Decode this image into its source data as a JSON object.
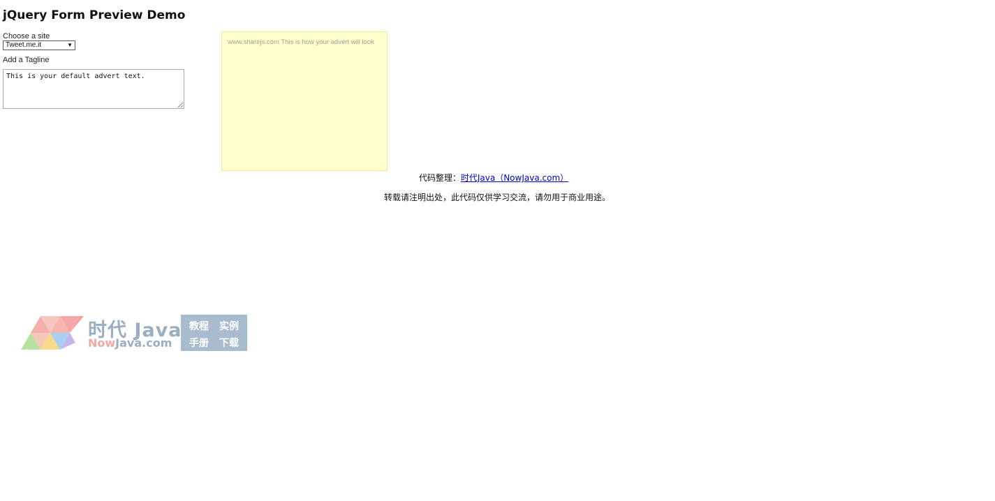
{
  "page": {
    "title": "jQuery Form Preview Demo"
  },
  "form": {
    "site_label": "Choose a site",
    "site_selected": "Tweet.me.it",
    "tagline_label": "Add a Tagline",
    "tagline_value": "This is your default advert text."
  },
  "preview": {
    "text": "www.sharejs.com This is how your advert will look",
    "background": "#ffffcc"
  },
  "footer": {
    "credit_prefix": "代码整理：",
    "credit_link": "时代Java（NowJava.com）",
    "notice": "转载请注明出处，此代码仅供学习交流，请勿用于商业用途。"
  },
  "watermark": {
    "brand": "时代 Java",
    "domain_now": "Now",
    "domain_rest": "Java.com",
    "cells": [
      "教程",
      "实例",
      "手册",
      "下载"
    ]
  },
  "icons": {
    "select_chevron": "chevron-down-icon",
    "resize": "resize-handle-icon",
    "logo": "nowjava-triangles-logo"
  }
}
